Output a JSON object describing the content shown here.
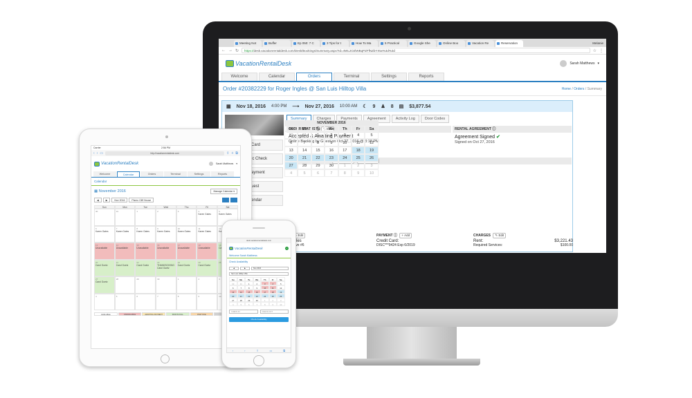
{
  "browser": {
    "tabs": [
      "Meeting Not",
      "Buffer",
      "Ep 050: 7 C",
      "3 Tips for t",
      "How To Ma",
      "5 Practical",
      "Google She",
      "Online Boo",
      "Vacation Re",
      "Reservation"
    ],
    "url_scheme": "https://",
    "url_rest": "desk.vacationrentaldesk.com/Desk/Bookings/Summary.aspx?Id=4WL2O2lWBqPZFfNZbYXtw%3d%3d",
    "profile": "Melanie"
  },
  "app": {
    "logo": "VacationRentalDesk",
    "user": "Sarah Matthews",
    "nav": [
      "Welcome",
      "Calendar",
      "Orders",
      "Terminal",
      "Settings",
      "Reports"
    ],
    "page_title": "Order #20382229 for Roger Ingles @ San Luis Hilltop Villa",
    "breadcrumb": {
      "home": "Home",
      "orders": "Orders",
      "current": "Summary",
      "sep": "/"
    }
  },
  "order": {
    "checkin_date": "Nov 18, 2016",
    "checkin_time": "4:00 PM",
    "arrow": "⟶",
    "checkout_date": "Nov 27, 2016",
    "checkout_time": "10:00 AM",
    "nights": "9",
    "guests": "8",
    "total": "$3,877.54",
    "subtabs": [
      "Summary",
      "Charges",
      "Payments",
      "Agreement",
      "Activity Log",
      "Door Codes"
    ],
    "side_items": [
      "Card",
      "ic Check",
      "ayment",
      "uest",
      "endar"
    ],
    "status_label": "ORDER STATUS",
    "status_value": "Accepted & Awaiting Payment",
    "status_sub": "Online Booking by Guest on Oct 27, 2016 @ 3:18 PM",
    "agreement_label": "RENTAL AGREEMENT",
    "agreement_value": "Agreement Signed",
    "agreement_sub": "Signed on Oct 27, 2016",
    "reservation_label": "RESERVATION DATES",
    "edit_dates": "Edit Dates",
    "edit_times": "Edit Times",
    "edit": "Edit",
    "add": "Add",
    "payment_label": "PAYMENT",
    "payment_card": "Credit Card:",
    "payment_num": "DISC***9424 Exp 6/2019",
    "guest_frag": "r Ingles",
    "addr_frag": "5th Ave #6",
    "guest_label": "T",
    "charges_label": "CHARGES",
    "rent_label": "Rent:",
    "rent_value": "$3,221.43",
    "req_label": "Required Services:",
    "req_value": "$100.00"
  },
  "reservation_cal": {
    "title": "NOVEMBER 2016",
    "dow": [
      "Su",
      "Mo",
      "Tu",
      "We",
      "Th",
      "Fr",
      "Sa"
    ],
    "days": [
      "30",
      "31",
      "1",
      "2",
      "3",
      "4",
      "5",
      "6",
      "7",
      "8",
      "9",
      "10",
      "11",
      "12",
      "13",
      "14",
      "15",
      "16",
      "17",
      "18",
      "19",
      "20",
      "21",
      "22",
      "23",
      "24",
      "25",
      "26",
      "27",
      "28",
      "29",
      "30",
      "1",
      "2",
      "3",
      "4",
      "5",
      "6",
      "7",
      "8",
      "9",
      "10"
    ],
    "muted_idx": [
      0,
      1,
      32,
      33,
      34,
      35,
      36,
      37,
      38,
      39,
      40,
      41
    ],
    "booked_idx": [
      19,
      20,
      21,
      22,
      23,
      24,
      25,
      26,
      27,
      28
    ]
  },
  "ipad": {
    "status_time": "2:56 PM",
    "status_left": "Carrier",
    "url": "http://vacationrentaldesk.com",
    "logo": "VacationRentalDesk",
    "user": "Sarah Matthews",
    "nav": [
      "Welcome",
      "Calendar",
      "Orders",
      "Terminal",
      "Settings",
      "Reports"
    ],
    "section": "Calendar",
    "month": "November 2016",
    "manage": "Manage Calendar",
    "prev": "◀",
    "next": "▶",
    "picker": "Nov 2016",
    "property": "Pismo Cliff House",
    "dow": [
      "Sun",
      "Mon",
      "Tue",
      "Wed",
      "Thu",
      "Fri",
      "Sat"
    ],
    "cells": [
      {
        "n": "30",
        "t": ""
      },
      {
        "n": "31",
        "t": ""
      },
      {
        "n": "1",
        "t": ""
      },
      {
        "n": "2",
        "t": ""
      },
      {
        "n": "3",
        "t": ""
      },
      {
        "n": "4",
        "t": "Karen Gates"
      },
      {
        "n": "5",
        "t": "Karen Gates"
      },
      {
        "n": "6",
        "t": "Karen Gates"
      },
      {
        "n": "7",
        "t": "Karen Gates"
      },
      {
        "n": "8",
        "t": "Karen Gates"
      },
      {
        "n": "9",
        "t": "Karen Gates"
      },
      {
        "n": "10",
        "t": "Karen Gates"
      },
      {
        "n": "11",
        "t": "Karen Gates"
      },
      {
        "n": "12",
        "t": "Karen Gates"
      },
      {
        "n": "13",
        "t": "Unavailable"
      },
      {
        "n": "14",
        "t": "Unavailable"
      },
      {
        "n": "15",
        "t": "Unavailable"
      },
      {
        "n": "16",
        "t": "Unavailable"
      },
      {
        "n": "17",
        "t": "Unavailable"
      },
      {
        "n": "18",
        "t": "Unavailable"
      },
      {
        "n": "19",
        "t": "Carol Goetz"
      },
      {
        "n": "20",
        "t": "Carol Goetz"
      },
      {
        "n": "21",
        "t": "Carol Goetz"
      },
      {
        "n": "22",
        "t": "Carol Goetz"
      },
      {
        "n": "23",
        "t": "THANKSGIVING Carol Goetz"
      },
      {
        "n": "24",
        "t": "Carol Goetz"
      },
      {
        "n": "25",
        "t": "Carol Goetz"
      },
      {
        "n": "26",
        "t": ""
      },
      {
        "n": "27",
        "t": "Carol Goetz"
      },
      {
        "n": "28",
        "t": ""
      },
      {
        "n": "29",
        "t": ""
      },
      {
        "n": "30",
        "t": ""
      },
      {
        "n": "1",
        "t": ""
      },
      {
        "n": "2",
        "t": ""
      },
      {
        "n": "3",
        "t": ""
      },
      {
        "n": "4",
        "t": ""
      },
      {
        "n": "5",
        "t": ""
      },
      {
        "n": "6",
        "t": ""
      },
      {
        "n": "7",
        "t": ""
      },
      {
        "n": "8",
        "t": ""
      },
      {
        "n": "9",
        "t": ""
      },
      {
        "n": "10",
        "t": ""
      }
    ],
    "pink_idx": [
      14,
      15,
      16,
      17,
      18,
      19
    ],
    "green_idx": [
      20,
      21,
      22,
      23,
      24,
      25,
      26,
      27,
      28
    ],
    "legend": [
      "AVAILABLE",
      "UNAVAILABLE",
      "AWAITING PAYMENT",
      "PAID IN FULL",
      "PAST DUE",
      "CLOSED"
    ],
    "legend_colors": [
      "#ffffff",
      "#f2bcbc",
      "#fbe6b0",
      "#d7efc9",
      "#f8d5a6",
      "#cfcfcf"
    ]
  },
  "iphone": {
    "url": "desk.vacationrentaldesk.com",
    "logo": "VacationRentalDesk",
    "welcome": "Welcome Sarah Matthews",
    "avail": "Check Availability",
    "prev": "◀",
    "next": "▶",
    "picker": "Nov 2016",
    "property": "San Luis Hilltop Villa",
    "dow": [
      "Su",
      "Mo",
      "Tu",
      "We",
      "Th",
      "Fr",
      "Sa"
    ],
    "days": [
      "30",
      "31",
      "1",
      "2",
      "3",
      "4",
      "5",
      "6",
      "7",
      "8",
      "9",
      "10",
      "11",
      "12",
      "13",
      "14",
      "15",
      "16",
      "17",
      "18",
      "19",
      "20",
      "21",
      "22",
      "23",
      "24",
      "25",
      "26",
      "27",
      "28",
      "29",
      "30",
      "1",
      "2",
      "3",
      "4",
      "5",
      "6",
      "7",
      "8",
      "9",
      "10"
    ],
    "muted_idx": [
      0,
      1,
      32,
      33,
      34,
      35,
      36,
      37,
      38,
      39,
      40,
      41
    ],
    "pink_idx": [
      4,
      5,
      11,
      12,
      14,
      15,
      16,
      17,
      18,
      19
    ],
    "blue_idx": [
      20,
      21,
      22,
      23,
      24,
      25,
      26,
      27
    ],
    "checkin": "CHECK-IN",
    "checkout": "CHECK-OUT",
    "button": "Check Availability"
  }
}
